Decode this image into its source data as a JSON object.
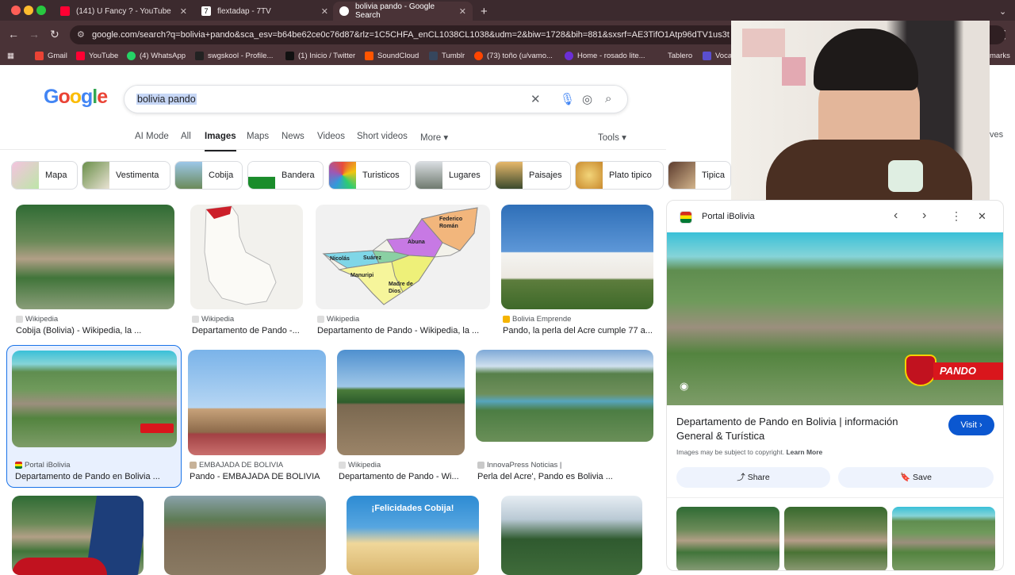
{
  "browser": {
    "tabs": [
      {
        "label": "(141) U Fancy ? - YouTube",
        "fav_color": "#ff0033"
      },
      {
        "label": "flextadap - 7TV",
        "fav_color": "#ffffff"
      },
      {
        "label": "bolivia pando - Google Search",
        "fav_color": "#ffffff"
      }
    ],
    "new_tab": "+",
    "url": "google.com/search?q=bolivia+pando&sca_esv=b64be62ce0c76d87&rlz=1C5CHFA_enCL1038CL1038&udm=2&biw=1728&bih=881&sxsrf=AE3TifO1Atp96dTV1us3t",
    "bookmarks": [
      {
        "label": "Gmail",
        "color": "#ea4335"
      },
      {
        "label": "YouTube",
        "color": "#ff0033"
      },
      {
        "label": "(4) WhatsApp",
        "color": "#25d366"
      },
      {
        "label": "swgskool - Profile...",
        "color": "#222222"
      },
      {
        "label": "(1) Inicio / Twitter",
        "color": "#111111"
      },
      {
        "label": "SoundCloud",
        "color": "#ff5500"
      },
      {
        "label": "Tumblr",
        "color": "#36465d"
      },
      {
        "label": "(73) toño (u/vamo...",
        "color": "#ff4500"
      },
      {
        "label": "Home - rosado lite...",
        "color": "#6b2fd6"
      },
      {
        "label": "Tablero",
        "color": "#3b2b2f"
      },
      {
        "label": "Voca",
        "color": "#5a4fcf"
      }
    ],
    "bookmarks_tail": "marks"
  },
  "google": {
    "logo": "Google",
    "query": "bolivia pando",
    "nav_tabs": [
      "AI Mode",
      "All",
      "Images",
      "Maps",
      "News",
      "Videos",
      "Short videos",
      "More"
    ],
    "selected_tab": "Images",
    "tools": "Tools",
    "more_right": "ves",
    "chips": [
      "Mapa",
      "Vestimenta",
      "Cobija",
      "Bandera",
      "Turisticos",
      "Lugares",
      "Paisajes",
      "Plato tipico",
      "Tipica"
    ],
    "results": [
      {
        "source": "Wikipedia",
        "title": "Cobija (Bolivia) - Wikipedia, la ..."
      },
      {
        "source": "Wikipedia",
        "title": "Departamento de Pando -..."
      },
      {
        "source": "Wikipedia",
        "title": "Departamento de Pando - Wikipedia, la ..."
      },
      {
        "source": "Bolivia Emprende",
        "title": "Pando, la perla del Acre cumple 77 a..."
      },
      {
        "source": "Portal iBolivia",
        "title": "Departamento de Pando en Bolivia ..."
      },
      {
        "source": "EMBAJADA DE BOLIVIA",
        "title": "Pando - EMBAJADA DE BOLIVIA"
      },
      {
        "source": "Wikipedia",
        "title": "Departamento de Pando - Wi..."
      },
      {
        "source": "InnovaPress Noticias |",
        "title": "Perla del Acre', Pando es Bolivia ..."
      }
    ],
    "map_labels": [
      "Federico Román",
      "Abuna",
      "Nicolás",
      "Suárez",
      "Manuripi",
      "Madre de Dios"
    ],
    "bottom_banner": "¡Felicidades Cobija!",
    "image_badge": "PANDO"
  },
  "panel": {
    "source": "Portal iBolivia",
    "title": "Departamento de Pando en Bolivia | información General & Turística",
    "visit": "Visit",
    "copyright": "Images may be subject to copyright.",
    "learn_more": "Learn More",
    "share": "Share",
    "save": "Save"
  }
}
